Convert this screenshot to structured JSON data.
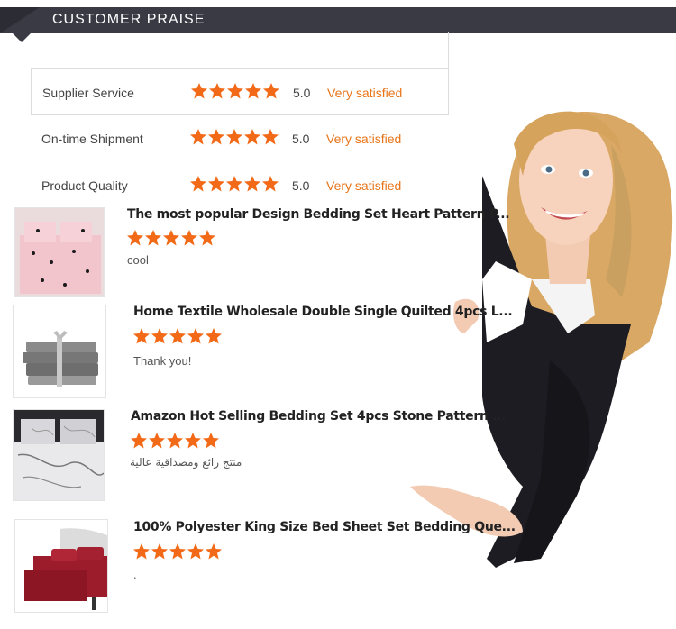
{
  "header": {
    "title": "CUSTOMER PRAISE"
  },
  "ratings": [
    {
      "label": "Supplier Service",
      "stars": 5,
      "score": "5.0",
      "verdict": "Very satisfied"
    },
    {
      "label": "On-time Shipment",
      "stars": 5,
      "score": "5.0",
      "verdict": "Very satisfied"
    },
    {
      "label": "Product Quality",
      "stars": 5,
      "score": "5.0",
      "verdict": "Very satisfied"
    }
  ],
  "reviews": [
    {
      "title": "The most popular Design Bedding Set Heart Pattern P...",
      "stars": 5,
      "comment": "cool",
      "thumb": "pink-heart-bedding"
    },
    {
      "title": "Home Textile Wholesale Double Single Quilted 4pcs L...",
      "stars": 5,
      "comment": "Thank you!",
      "thumb": "gray-folded-sheets"
    },
    {
      "title": "Amazon Hot Selling Bedding Set 4pcs Stone Pattern ...",
      "stars": 5,
      "comment": "منتج رائع ومصداقية عالية",
      "thumb": "marble-bedding"
    },
    {
      "title": "100% Polyester King Size Bed Sheet Set Bedding Que...",
      "stars": 5,
      "comment": ".",
      "thumb": "red-bed-sheets"
    }
  ],
  "colors": {
    "banner": "#3a3a45",
    "star": "#f26a17",
    "verdict": "#e8751a"
  },
  "illustration": "smiling-woman-pointing"
}
